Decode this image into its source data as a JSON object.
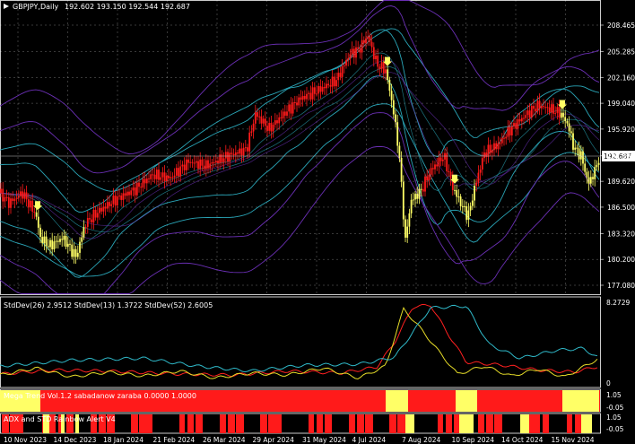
{
  "main": {
    "symbol": "GBPJPY,Daily",
    "ohlc": "192.602 193.150 192.544 192.687",
    "last_price": "192.687",
    "price_ticks": [
      "208.465",
      "205.285",
      "202.160",
      "199.040",
      "195.920",
      "192.687",
      "189.620",
      "186.500",
      "183.320",
      "180.200",
      "177.080"
    ]
  },
  "stddev_panel": {
    "header": "StdDev(26) 2.9512  StdDev(13) 1.3722  StdDev(52) 2.6005",
    "top_value": "8.2729",
    "bottom_value": "0"
  },
  "mega_trend": {
    "header": "Mega Trend Vol.1.2 sabadanow zaraba 0.0000 1.0000",
    "ticks": [
      "1.05",
      "-0.05"
    ]
  },
  "adx": {
    "header": "ADX and STD Rainbow Alert V4",
    "ticks": [
      "1.05",
      "-0.05"
    ]
  },
  "time_axis": [
    "10 Nov 2023",
    "14 Dec 2023",
    "18 Jan 2024",
    "21 Feb 2024",
    "26 Mar 2024",
    "29 Apr 2024",
    "31 May 2024",
    "4 Jul 2024",
    "7 Aug 2024",
    "10 Sep 2024",
    "14 Oct 2024",
    "15 Nov 2024"
  ],
  "colors": {
    "bull": "#ff1a1a",
    "bear": "#ffff66",
    "band_outer": "#6a2fb4",
    "band_inner": "#2aa6b8",
    "grid": "#ffffff",
    "std26": "#ff2020",
    "std13": "#e6dc28",
    "std52": "#2fb8c8"
  },
  "chart_data": {
    "type": "candlestick",
    "price_range": [
      177.08,
      208.465
    ],
    "std_range": [
      0,
      8.2729
    ],
    "price_path": [
      [
        0,
        188.2
      ],
      [
        10,
        187.0
      ],
      [
        25,
        188.2
      ],
      [
        40,
        185.6
      ],
      [
        45,
        182.8
      ],
      [
        55,
        181.8
      ],
      [
        70,
        182.8
      ],
      [
        85,
        180.5
      ],
      [
        95,
        184.5
      ],
      [
        110,
        186.0
      ],
      [
        130,
        187.5
      ],
      [
        150,
        188.6
      ],
      [
        170,
        190.4
      ],
      [
        190,
        190.0
      ],
      [
        210,
        192.0
      ],
      [
        230,
        191.5
      ],
      [
        250,
        192.5
      ],
      [
        275,
        193.5
      ],
      [
        285,
        197.8
      ],
      [
        300,
        195.9
      ],
      [
        315,
        197.6
      ],
      [
        335,
        199.6
      ],
      [
        355,
        200.6
      ],
      [
        375,
        201.8
      ],
      [
        390,
        205.0
      ],
      [
        400,
        205.5
      ],
      [
        410,
        207.2
      ],
      [
        420,
        203.8
      ],
      [
        430,
        203.0
      ],
      [
        438,
        198.6
      ],
      [
        445,
        193.0
      ],
      [
        452,
        182.4
      ],
      [
        458,
        187.2
      ],
      [
        470,
        188.6
      ],
      [
        480,
        190.9
      ],
      [
        495,
        192.7
      ],
      [
        505,
        188.8
      ],
      [
        515,
        186.7
      ],
      [
        522,
        185.4
      ],
      [
        530,
        189.2
      ],
      [
        540,
        193.0
      ],
      [
        555,
        194.0
      ],
      [
        570,
        196.0
      ],
      [
        585,
        197.5
      ],
      [
        600,
        198.8
      ],
      [
        612,
        198.4
      ],
      [
        625,
        197.8
      ],
      [
        633,
        196.5
      ],
      [
        640,
        193.6
      ],
      [
        648,
        192.7
      ],
      [
        656,
        189.3
      ],
      [
        663,
        190.8
      ],
      [
        668,
        192.5
      ]
    ],
    "bear_segments": [
      [
        40,
        95
      ],
      [
        430,
        470
      ],
      [
        505,
        530
      ],
      [
        625,
        668
      ]
    ],
    "std_series": [
      {
        "values": [
          [
            0,
            1.0
          ],
          [
            60,
            1.4
          ],
          [
            120,
            1.3
          ],
          [
            200,
            1.0
          ],
          [
            260,
            0.9
          ],
          [
            320,
            1.3
          ],
          [
            380,
            1.1
          ],
          [
            420,
            1.7
          ],
          [
            440,
            4.2
          ],
          [
            460,
            7.8
          ],
          [
            480,
            8.0
          ],
          [
            500,
            5.0
          ],
          [
            520,
            2.2
          ],
          [
            560,
            1.9
          ],
          [
            600,
            1.4
          ],
          [
            640,
            1.2
          ],
          [
            668,
            1.8
          ]
        ]
      },
      {
        "values": [
          [
            0,
            0.9
          ],
          [
            40,
            1.6
          ],
          [
            80,
            0.7
          ],
          [
            120,
            1.2
          ],
          [
            160,
            0.8
          ],
          [
            200,
            1.3
          ],
          [
            240,
            0.6
          ],
          [
            280,
            1.1
          ],
          [
            320,
            0.9
          ],
          [
            360,
            1.6
          ],
          [
            400,
            0.6
          ],
          [
            430,
            1.8
          ],
          [
            450,
            7.6
          ],
          [
            470,
            5.5
          ],
          [
            490,
            3.2
          ],
          [
            510,
            1.0
          ],
          [
            540,
            1.8
          ],
          [
            570,
            0.8
          ],
          [
            600,
            1.5
          ],
          [
            630,
            0.7
          ],
          [
            668,
            2.6
          ]
        ]
      },
      {
        "values": [
          [
            0,
            1.8
          ],
          [
            80,
            2.4
          ],
          [
            160,
            2.6
          ],
          [
            220,
            1.8
          ],
          [
            280,
            1.3
          ],
          [
            340,
            1.9
          ],
          [
            400,
            2.0
          ],
          [
            440,
            2.7
          ],
          [
            480,
            7.7
          ],
          [
            520,
            7.9
          ],
          [
            545,
            4.0
          ],
          [
            580,
            2.6
          ],
          [
            620,
            3.4
          ],
          [
            650,
            3.6
          ],
          [
            668,
            2.6
          ]
        ]
      }
    ],
    "mega_trend_bear": [
      [
        0,
        45
      ],
      [
        430,
        455
      ],
      [
        508,
        532
      ],
      [
        627,
        668
      ]
    ],
    "adx_bear": [
      [
        48,
        55
      ],
      [
        68,
        72
      ],
      [
        84,
        88
      ],
      [
        452,
        462
      ],
      [
        512,
        528
      ],
      [
        580,
        590
      ],
      [
        648,
        660
      ]
    ]
  }
}
